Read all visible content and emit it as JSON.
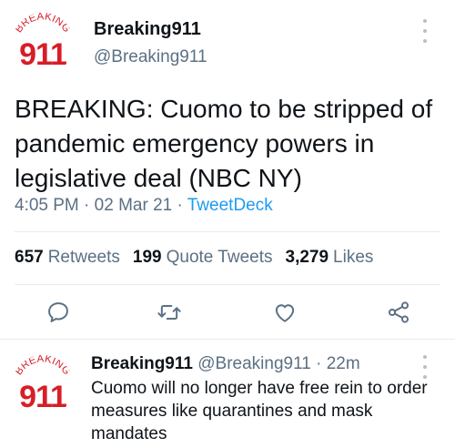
{
  "colors": {
    "brand_red": "#d71e28",
    "link_blue": "#1d9bf0",
    "secondary_text": "#5b7083"
  },
  "main_tweet": {
    "avatar_text_top": "BREAKING",
    "avatar_text_number": "911",
    "display_name": "Breaking911",
    "handle": "@Breaking911",
    "text": "BREAKING: Cuomo to be stripped of pandemic emergency powers in legislative deal (NBC NY)",
    "time": "4:05 PM",
    "date": "02 Mar 21",
    "source": "TweetDeck",
    "stats": {
      "retweets_count": "657",
      "retweets_label": "Retweets",
      "quotes_count": "199",
      "quotes_label": "Quote Tweets",
      "likes_count": "3,279",
      "likes_label": "Likes"
    },
    "actions": [
      "reply-icon",
      "retweet-icon",
      "like-icon",
      "share-icon"
    ]
  },
  "reply_tweet": {
    "avatar_text_top": "BREAKING",
    "avatar_text_number": "911",
    "display_name": "Breaking911",
    "handle": "@Breaking911",
    "age": "22m",
    "text": "Cuomo will no longer have free rein to order measures like quarantines and mask mandates"
  }
}
